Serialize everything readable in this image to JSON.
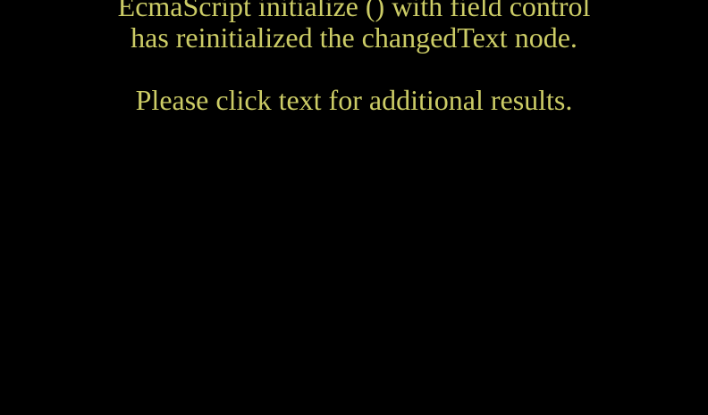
{
  "scene": {
    "text_color": "#cccc66",
    "background_color": "#000000",
    "lines": [
      "EcmaScript initialize () with field control",
      "has reinitialized the changedText node.",
      "",
      "Please click text for additional results."
    ]
  }
}
